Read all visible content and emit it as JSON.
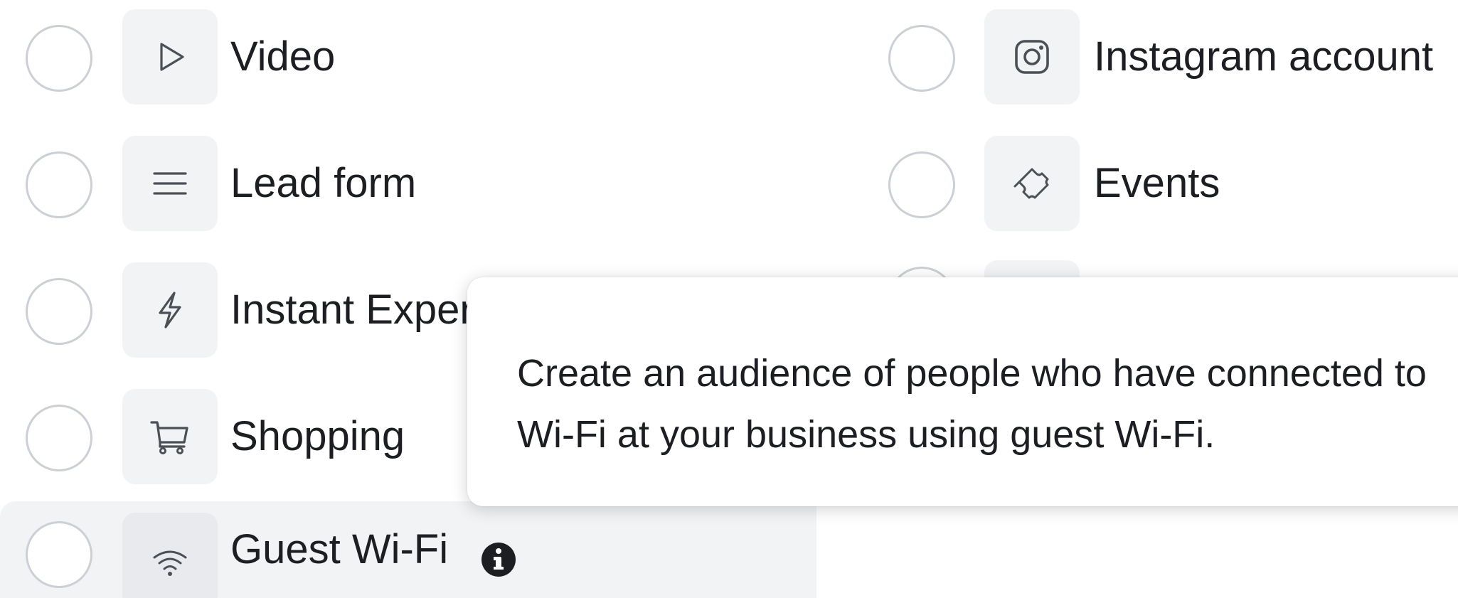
{
  "left_options": [
    {
      "label": "Video",
      "icon": "play-icon"
    },
    {
      "label": "Lead form",
      "icon": "lines-icon"
    },
    {
      "label": "Instant Exper",
      "icon": "lightning-icon"
    },
    {
      "label": "Shopping",
      "icon": "cart-icon"
    },
    {
      "label": "Guest Wi-Fi",
      "icon": "wifi-icon"
    }
  ],
  "right_options": [
    {
      "label": "Instagram account",
      "icon": "instagram-icon"
    },
    {
      "label": "Events",
      "icon": "ticket-icon"
    }
  ],
  "tooltip": {
    "text": "Create an audience of people who have connected to Wi-Fi at your business using guest Wi-Fi."
  },
  "colors": {
    "tile_bg": "#f2f3f5",
    "radio_border": "#ccd0d5",
    "text": "#1c1e21",
    "highlight_bg": "#f2f3f5"
  }
}
